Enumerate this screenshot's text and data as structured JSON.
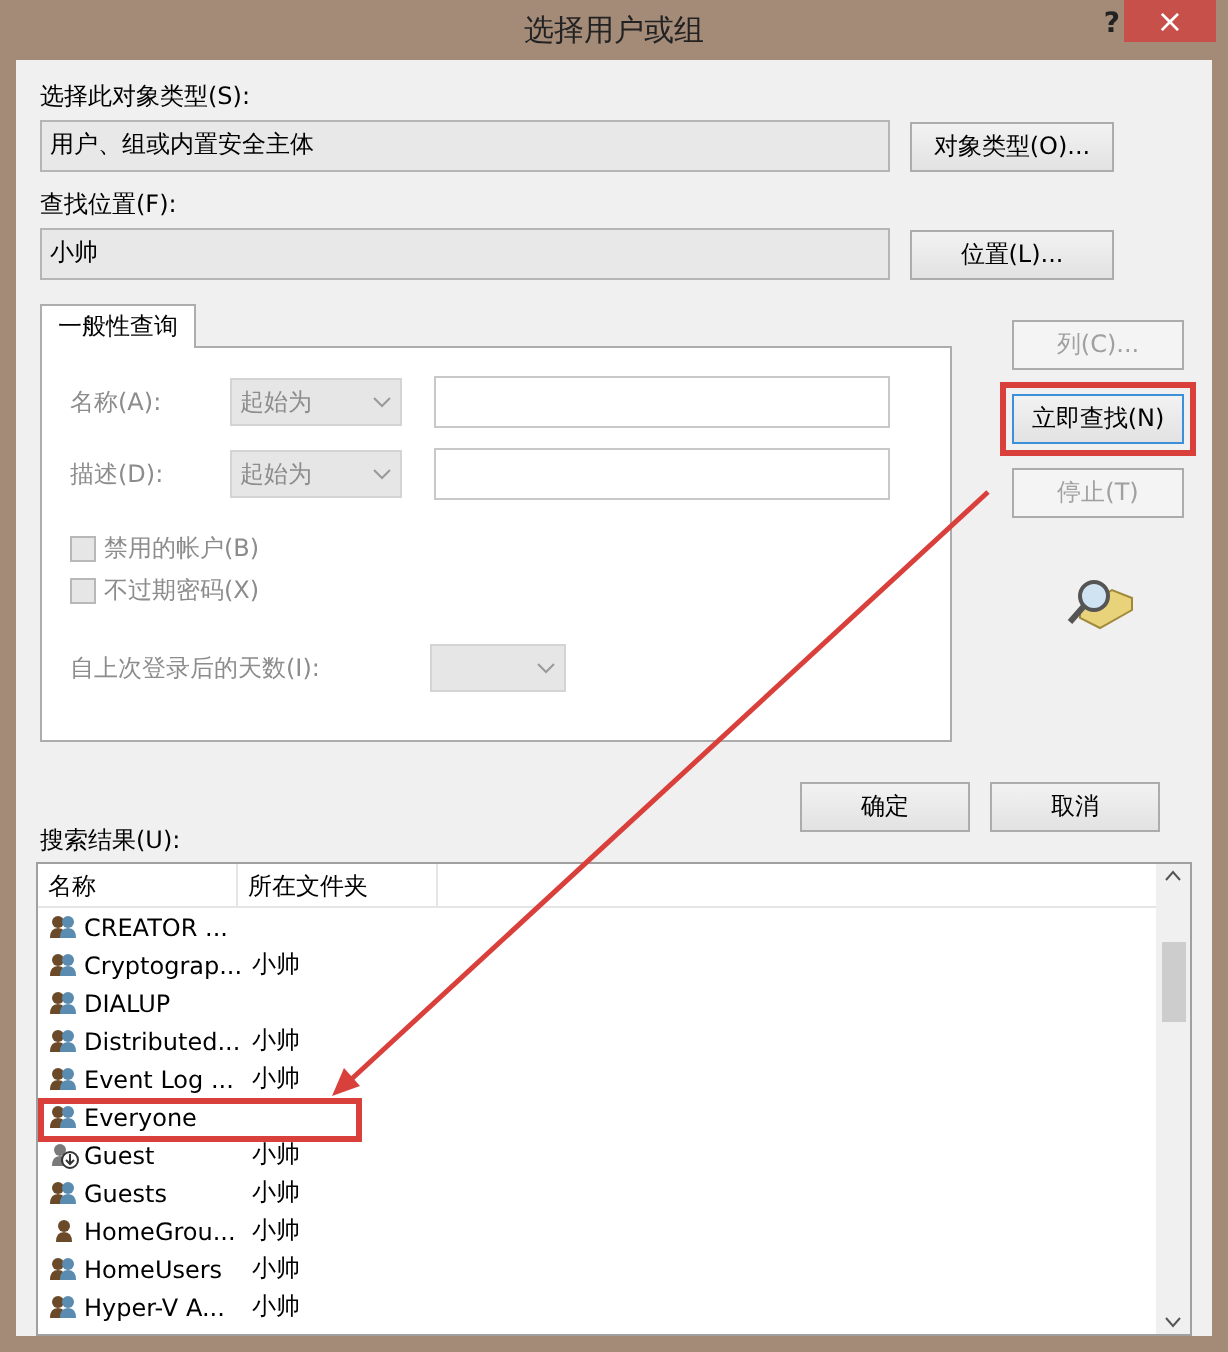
{
  "window": {
    "title": "选择用户或组",
    "help": "?",
    "close": "×"
  },
  "object_type": {
    "label": "选择此对象类型(S):",
    "value": "用户、组或内置安全主体",
    "button": "对象类型(O)..."
  },
  "location": {
    "label": "查找位置(F):",
    "value": "小帅",
    "button": "位置(L)..."
  },
  "tabs": [
    {
      "label": "一般性查询",
      "selected": true
    }
  ],
  "query": {
    "fields": [
      {
        "label": "名称(A):",
        "mode": "起始为",
        "disabled": true
      },
      {
        "label": "描述(D):",
        "mode": "起始为",
        "disabled": true
      }
    ],
    "checkboxes": [
      {
        "label": "禁用的帐户(B)",
        "checked": false,
        "disabled": true
      },
      {
        "label": "不过期密码(X)",
        "checked": false,
        "disabled": true
      }
    ],
    "days": {
      "label": "自上次登录后的天数(I):",
      "disabled": true
    }
  },
  "side_buttons": [
    {
      "label": "列(C)...",
      "disabled": true,
      "highlighted": false
    },
    {
      "label": "立即查找(N)",
      "disabled": false,
      "highlighted": true
    },
    {
      "label": "停止(T)",
      "disabled": true,
      "highlighted": false
    }
  ],
  "dialog_buttons": [
    "确定",
    "取消"
  ],
  "results": {
    "label": "搜索结果(U):",
    "columns": [
      "名称",
      "所在文件夹"
    ],
    "rows": [
      {
        "kind": "group",
        "name": "CREATOR ...",
        "folder": "",
        "highlighted": false
      },
      {
        "kind": "group",
        "name": "Cryptograp...",
        "folder": "小帅",
        "highlighted": false
      },
      {
        "kind": "group",
        "name": "DIALUP",
        "folder": "",
        "highlighted": false
      },
      {
        "kind": "group",
        "name": "Distributed...",
        "folder": "小帅",
        "highlighted": false
      },
      {
        "kind": "group",
        "name": "Event Log ...",
        "folder": "小帅",
        "highlighted": false
      },
      {
        "kind": "group",
        "name": "Everyone",
        "folder": "",
        "highlighted": true
      },
      {
        "kind": "guest",
        "name": "Guest",
        "folder": "小帅",
        "highlighted": false
      },
      {
        "kind": "group",
        "name": "Guests",
        "folder": "小帅",
        "highlighted": false
      },
      {
        "kind": "user",
        "name": "HomeGrou...",
        "folder": "小帅",
        "highlighted": false
      },
      {
        "kind": "group",
        "name": "HomeUsers",
        "folder": "小帅",
        "highlighted": false
      },
      {
        "kind": "group",
        "name": "Hyper-V A...",
        "folder": "小帅",
        "highlighted": false
      }
    ]
  }
}
